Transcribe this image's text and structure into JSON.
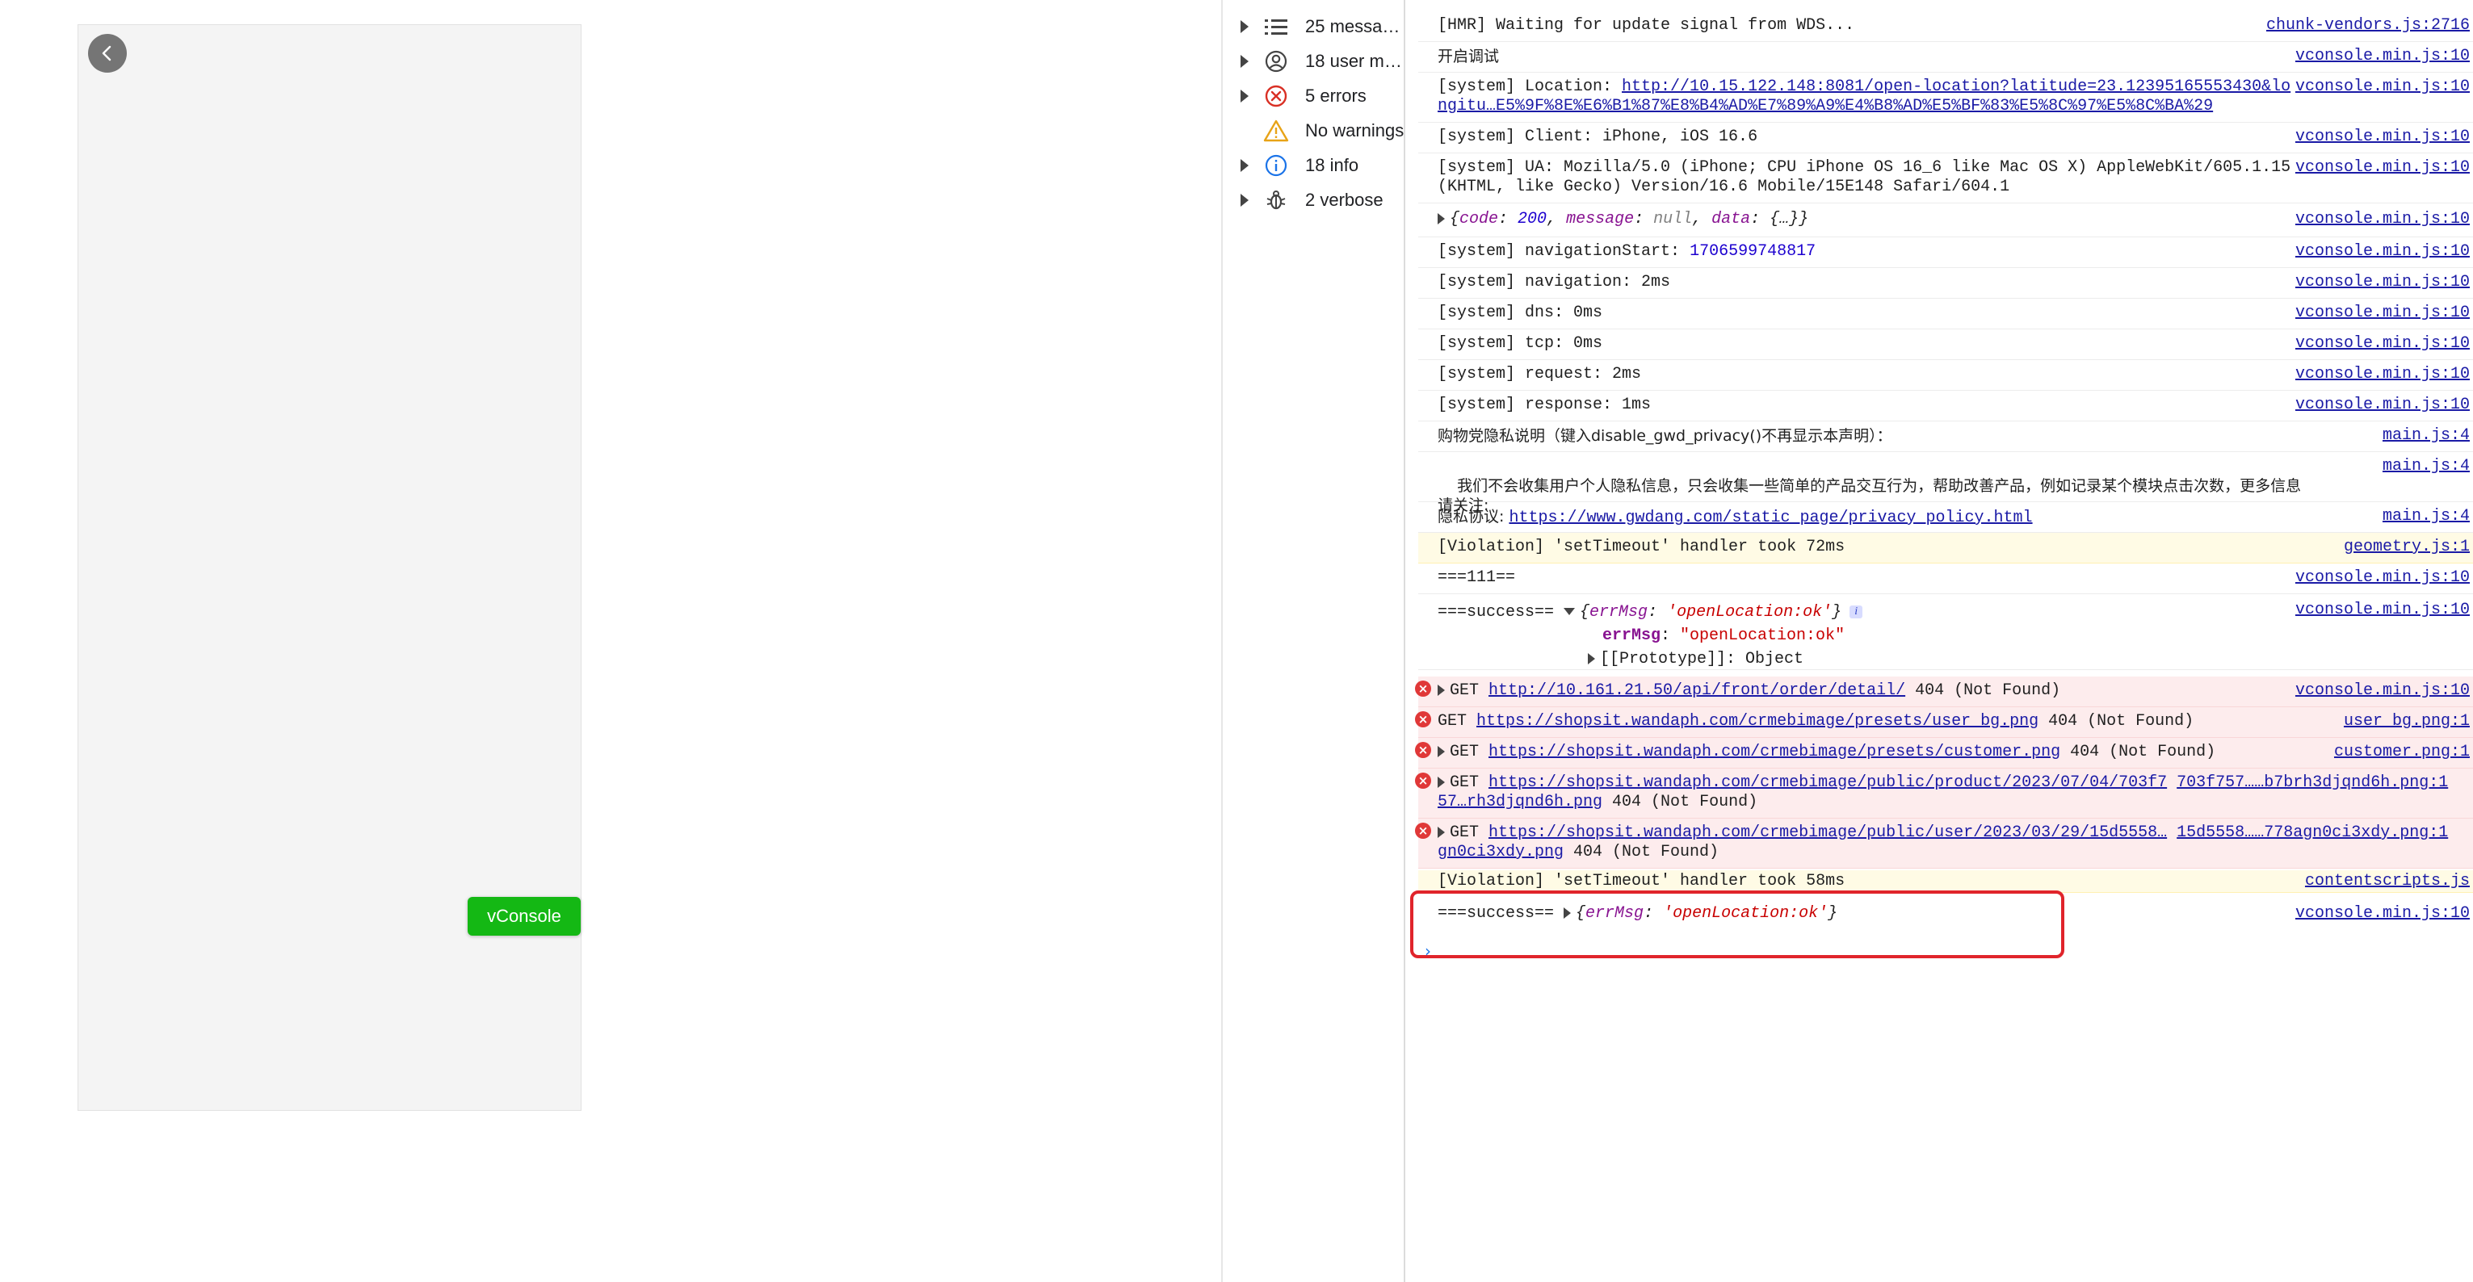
{
  "phone": {
    "vconsole_label": "vConsole"
  },
  "sidebar": {
    "items": [
      {
        "label": "25 messa…",
        "icon": "list-icon"
      },
      {
        "label": "18 user m…",
        "icon": "user-icon"
      },
      {
        "label": "5 errors",
        "icon": "error-icon"
      },
      {
        "label": "No warnings",
        "icon": "warning-icon"
      },
      {
        "label": "18 info",
        "icon": "info-icon"
      },
      {
        "label": "2 verbose",
        "icon": "bug-icon"
      }
    ]
  },
  "console": {
    "r1": {
      "text": "[HMR] Waiting for update signal from WDS...",
      "src": "chunk-vendors.js:2716"
    },
    "r2": {
      "text": "开启调试",
      "src": "vconsole.min.js:10"
    },
    "r3": {
      "prefix": "[system] Location: ",
      "link1": "http://10.15.122.148:8081/open-location?latitude=23.12395165553430&lo",
      "link2": "ngitu…E5%9F%8E%E6%B1%87%E8%B4%AD%E7%89%A9%E4%B8%AD%E5%BF%83%E5%8C%97%E5%8C%BA%29",
      "src": "vconsole.min.js:10"
    },
    "r4": {
      "text": "[system] Client: iPhone, iOS 16.6",
      "src": "vconsole.min.js:10"
    },
    "r5": {
      "line1": "[system] UA: Mozilla/5.0 (iPhone; CPU iPhone OS 16_6 like Mac OS X) AppleWebKit/605.1.15",
      "line2": "(KHTML, like Gecko) Version/16.6 Mobile/15E148 Safari/604.1",
      "src": "vconsole.min.js:10"
    },
    "r6": {
      "open": "{",
      "k1": "code",
      "v1": "200",
      "k2": "message",
      "v2": "null",
      "k3": "data",
      "v3": "{…}",
      "close": "}",
      "src": "vconsole.min.js:10"
    },
    "r7": {
      "prefix": "[system] navigationStart: ",
      "value": "1706599748817",
      "src": "vconsole.min.js:10"
    },
    "r8": {
      "text": "[system] navigation: 2ms",
      "src": "vconsole.min.js:10"
    },
    "r9": {
      "text": "[system] dns: 0ms",
      "src": "vconsole.min.js:10"
    },
    "r10": {
      "text": "[system] tcp: 0ms",
      "src": "vconsole.min.js:10"
    },
    "r11": {
      "text": "[system] request: 2ms",
      "src": "vconsole.min.js:10"
    },
    "r12": {
      "text": "[system] response: 1ms",
      "src": "vconsole.min.js:10"
    },
    "r13": {
      "text": "购物党隐私说明（键入disable_gwd_privacy()不再显示本声明）：",
      "src": "main.js:4"
    },
    "r14": {
      "line1": "    我们不会收集用户个人隐私信息，只会收集一些简单的产品交互行为，帮助改善产品，例如记录某个模块点击次数，更多信息",
      "line2": "请关注:",
      "src": "main.js:4"
    },
    "r15": {
      "prefix": "隐私协议: ",
      "link": "https://www.gwdang.com/static_page/privacy_policy.html",
      "src": "main.js:4"
    },
    "r16": {
      "text": "[Violation] 'setTimeout' handler took 72ms",
      "src": "geometry.js:1"
    },
    "r17": {
      "text": "===111==",
      "src": "vconsole.min.js:10"
    },
    "r18": {
      "prefix": "===success== ",
      "key": "errMsg",
      "val": "'openLocation:ok'",
      "expanded_key": "errMsg",
      "expanded_val": "\"openLocation:ok\"",
      "proto": "[[Prototype]]: Object",
      "src": "vconsole.min.js:10"
    },
    "e1": {
      "method": "GET ",
      "link": "http://10.161.21.50/api/front/order/detail/",
      "status": " 404 (Not Found)",
      "src": "vconsole.min.js:10"
    },
    "e2": {
      "method": "GET ",
      "link": "https://shopsit.wandaph.com/crmebimage/presets/user_bg.png",
      "status": " 404 (Not Found)",
      "src": "user_bg.png:1"
    },
    "e3": {
      "method": "GET ",
      "link": "https://shopsit.wandaph.com/crmebimage/presets/customer.png",
      "status": " 404 (Not Found)",
      "src": "customer.png:1"
    },
    "e4": {
      "method": "GET ",
      "link": "https://shopsit.wandaph.com/crmebimage/public/product/2023/07/04/703f7",
      "link_b": "703f757……b7brh3djqnd6h.png:1",
      "line2_link": "57…rh3djqnd6h.png",
      "status": " 404 (Not Found)"
    },
    "e5": {
      "method": "GET ",
      "link": "https://shopsit.wandaph.com/crmebimage/public/user/2023/03/29/15d5558…",
      "link_b": "15d5558……778agn0ci3xdy.png:1",
      "line2_link": "gn0ci3xdy.png",
      "status": " 404 (Not Found)"
    },
    "r19": {
      "text": "[Violation] 'setTimeout' handler took 58ms",
      "src": "contentscripts.js"
    },
    "r20": {
      "prefix": "===success== ",
      "key": "errMsg",
      "val": "'openLocation:ok'",
      "src": "vconsole.min.js:10"
    },
    "prompt": "›"
  }
}
